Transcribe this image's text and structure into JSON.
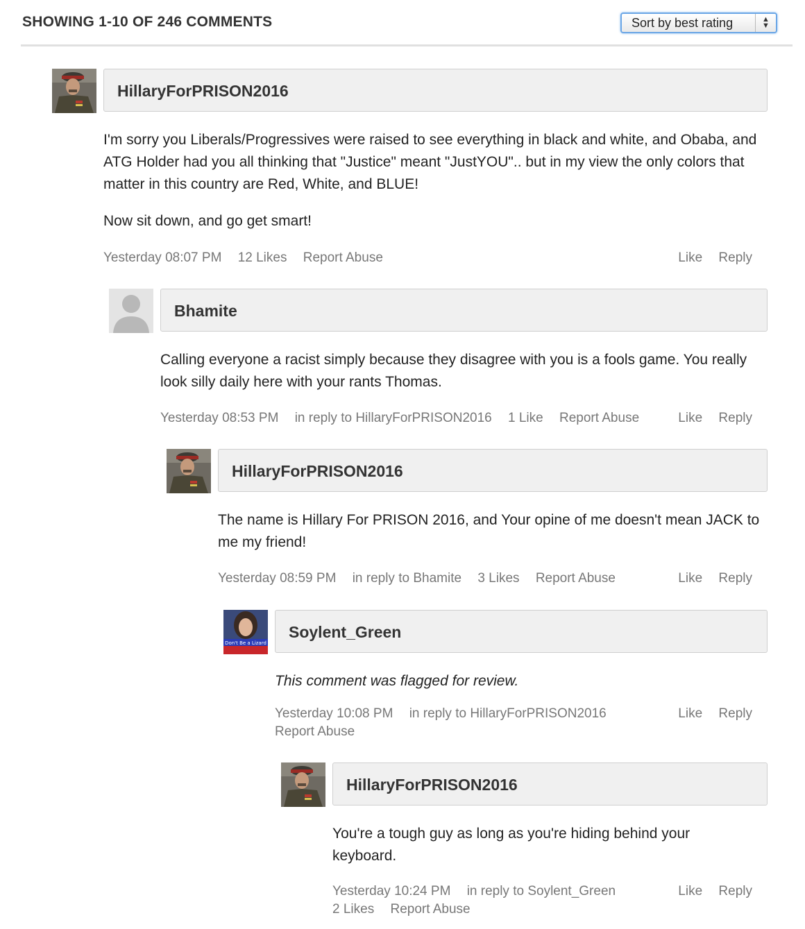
{
  "header": {
    "title": "SHOWING 1-10 OF 246 COMMENTS",
    "sort_selected": "Sort by best rating"
  },
  "comments": [
    {
      "author": "HillaryForPRISON2016",
      "avatar": "military-officer-avatar",
      "body": [
        "I'm sorry you Liberals/Progressives were raised to see everything in black and white, and Obaba, and ATG Holder had you all thinking that \"Justice\" meant \"JustYOU\".. but in my view the only colors that matter in this country are Red, White, and BLUE!",
        "Now sit down, and go get smart!"
      ],
      "time": "Yesterday 08:07 PM",
      "likes": "12 Likes",
      "report": "Report Abuse",
      "like": "Like",
      "reply": "Reply"
    },
    {
      "author": "Bhamite",
      "avatar": "default-user-avatar",
      "body": [
        "Calling everyone a racist simply because they disagree with you is a fools game.  You really look silly daily here with your rants Thomas."
      ],
      "time": "Yesterday 08:53 PM",
      "in_reply": "in reply to HillaryForPRISON2016",
      "likes": "1 Like",
      "report": "Report Abuse",
      "like": "Like",
      "reply": "Reply"
    },
    {
      "author": "HillaryForPRISON2016",
      "avatar": "military-officer-avatar",
      "body": [
        "The name is Hillary For PRISON 2016, and Your opine of me doesn't mean JACK to me my friend!"
      ],
      "time": "Yesterday 08:59 PM",
      "in_reply": "in reply to Bhamite",
      "likes": "3 Likes",
      "report": "Report Abuse",
      "like": "Like",
      "reply": "Reply"
    },
    {
      "author": "Soylent_Green",
      "avatar": "woman-photo-avatar",
      "avatar_caption": "Don't Be a Lizard",
      "body": [
        "This comment was flagged for review."
      ],
      "time": "Yesterday 10:08 PM",
      "in_reply": "in reply to HillaryForPRISON2016",
      "report": "Report Abuse",
      "like": "Like",
      "reply": "Reply"
    },
    {
      "author": "HillaryForPRISON2016",
      "avatar": "military-officer-avatar",
      "body": [
        "You're a tough guy as long as you're hiding behind your keyboard."
      ],
      "time": "Yesterday 10:24 PM",
      "in_reply": "in reply to Soylent_Green",
      "likes": "2 Likes",
      "report": "Report Abuse",
      "like": "Like",
      "reply": "Reply"
    }
  ]
}
